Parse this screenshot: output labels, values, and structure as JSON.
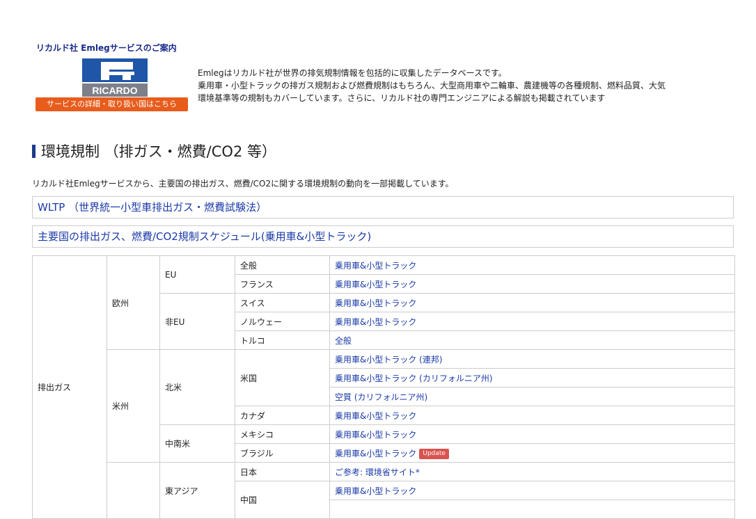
{
  "service": {
    "title": "リカルド社 Emlegサービスのご案内",
    "logo_text": "RICARDO",
    "button_label": "サービスの詳細・取り扱い国はこちら",
    "description": [
      "Emlegはリカルド社が世界の排気規制情報を包括的に収集したデータベースです。",
      "乗用車・小型トラックの排ガス規制および燃費規制はもちろん、大型商用車や二輪車、農建機等の各種規制、燃料品質、大気",
      "環境基準等の規制もカバーしています。さらに、リカルド社の専門エンジニアによる解説も掲載されています"
    ]
  },
  "section": {
    "title": "環境規制 （排ガス・燃費/CO2 等）",
    "intro": "リカルド社Emlegサービスから、主要国の排出ガス、燃費/CO2に関する環境規制の動向を一部掲載しています。",
    "links": [
      "WLTP （世界統一小型車排出ガス・燃費試験法）",
      "主要国の排出ガス、燃費/CO2規制スケジュール(乗用車&小型トラック)"
    ]
  },
  "table": {
    "category": "排出ガス",
    "regions": {
      "europe": "欧州",
      "americas": "米州"
    },
    "subregions": {
      "eu": "EU",
      "non_eu": "非EU",
      "north_america": "北米",
      "latin_america": "中南米",
      "east_asia": "東アジア"
    },
    "rows": [
      {
        "country": "全般",
        "link": "乗用車&小型トラック"
      },
      {
        "country": "フランス",
        "link": "乗用車&小型トラック"
      },
      {
        "country": "スイス",
        "link": "乗用車&小型トラック"
      },
      {
        "country": "ノルウェー",
        "link": "乗用車&小型トラック"
      },
      {
        "country": "トルコ",
        "link": "全般"
      },
      {
        "country": "米国",
        "link": "乗用車&小型トラック (連邦)"
      },
      {
        "country": "",
        "link": "乗用車&小型トラック (カリフォルニア州)"
      },
      {
        "country": "",
        "link": "空質 (カリフォルニア州)"
      },
      {
        "country": "カナダ",
        "link": "乗用車&小型トラック"
      },
      {
        "country": "メキシコ",
        "link": "乗用車&小型トラック"
      },
      {
        "country": "ブラジル",
        "link": "乗用車&小型トラック",
        "badge": "Update"
      },
      {
        "country": "日本",
        "link": "ご参考: 環境省サイト*"
      },
      {
        "country": "中国",
        "link": "乗用車&小型トラック"
      }
    ]
  },
  "colors": {
    "link": "#1a3aa8",
    "button": "#e85c1c",
    "badge": "#d9534f",
    "accent_bar": "#1a3a8a"
  }
}
